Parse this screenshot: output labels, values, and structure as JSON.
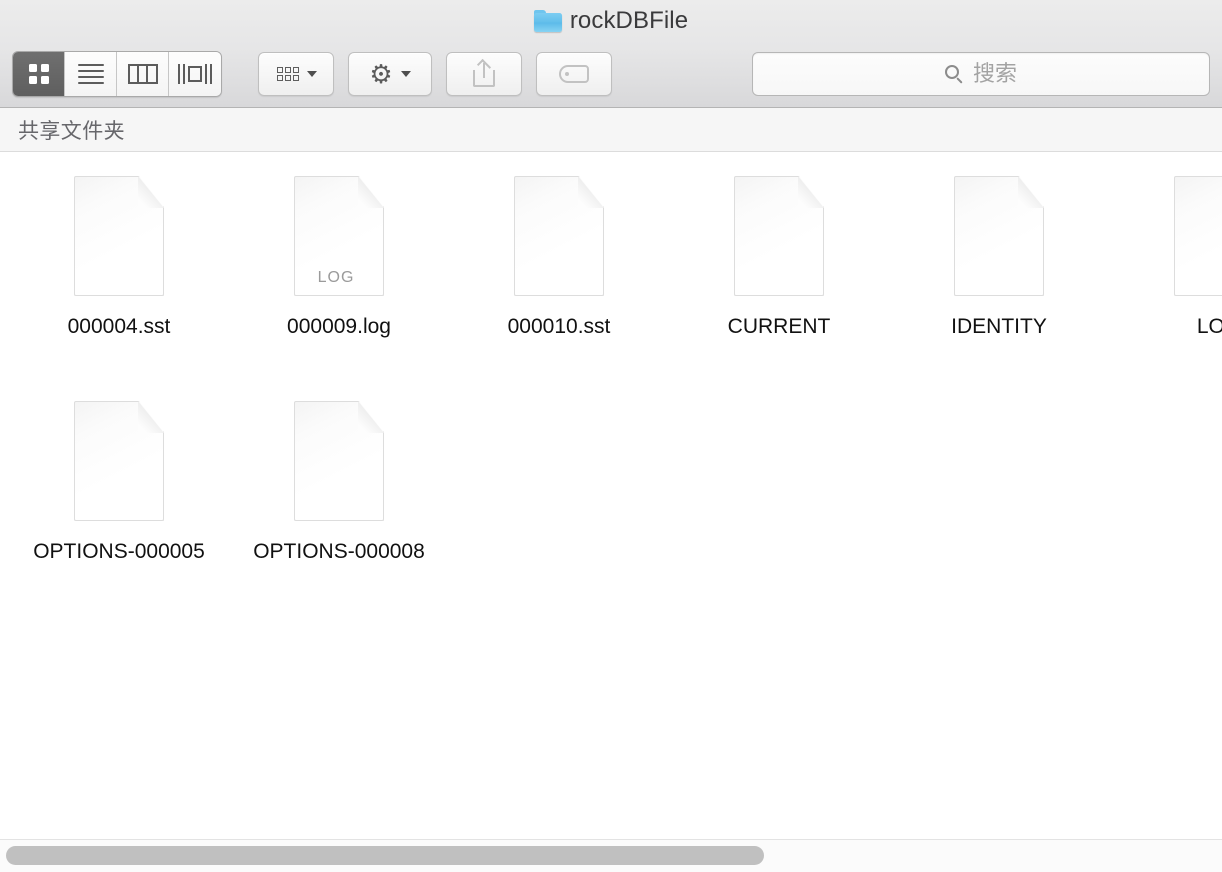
{
  "window": {
    "title": "rockDBFile",
    "folder_icon": "folder-icon"
  },
  "toolbar": {
    "view_modes": [
      {
        "name": "icon-view",
        "icon": "grid-icon",
        "active": true
      },
      {
        "name": "list-view",
        "icon": "list-lines-icon",
        "active": false
      },
      {
        "name": "column-view",
        "icon": "columns-icon",
        "active": false
      },
      {
        "name": "gallery-view",
        "icon": "coverflow-icon",
        "active": false
      }
    ],
    "arrange_button": {
      "name": "arrange-button",
      "icon": "arrange-grid-icon",
      "chevron": "chevron-down-icon"
    },
    "action_button": {
      "name": "action-button",
      "icon": "gear-icon",
      "glyph": "⚙",
      "chevron": "chevron-down-icon"
    },
    "share_button": {
      "name": "share-button",
      "icon": "share-icon",
      "enabled": false
    },
    "tag_button": {
      "name": "tag-button",
      "icon": "tag-icon",
      "enabled": false
    }
  },
  "search": {
    "icon": "search-icon",
    "placeholder": "搜索",
    "value": ""
  },
  "section": {
    "header_label": "共享文件夹"
  },
  "files": [
    {
      "name": "000004.sst",
      "badge": "",
      "icon": "document-icon"
    },
    {
      "name": "000009.log",
      "badge": "LOG",
      "icon": "document-icon"
    },
    {
      "name": "000010.sst",
      "badge": "",
      "icon": "document-icon"
    },
    {
      "name": "CURRENT",
      "badge": "",
      "icon": "document-icon"
    },
    {
      "name": "IDENTITY",
      "badge": "",
      "icon": "document-icon"
    },
    {
      "name": "LOG",
      "badge": "",
      "icon": "document-icon"
    },
    {
      "name": "OPTIONS-000005",
      "badge": "",
      "icon": "document-icon"
    },
    {
      "name": "OPTIONS-000008",
      "badge": "",
      "icon": "document-icon"
    }
  ],
  "scrollbar": {
    "orientation": "horizontal",
    "thumb_fraction_percent": 62
  },
  "colors": {
    "folder_blue": "#63bfeb",
    "toolbar_top": "#ececec",
    "toolbar_bottom": "#d8d8da",
    "section_header_bg": "#f6f6f6",
    "section_header_text": "#67676b",
    "active_segment": "#5f5f5f",
    "scroll_thumb": "#c0c0c0",
    "label_text": "#111111",
    "placeholder_text": "#a3a3a3"
  }
}
